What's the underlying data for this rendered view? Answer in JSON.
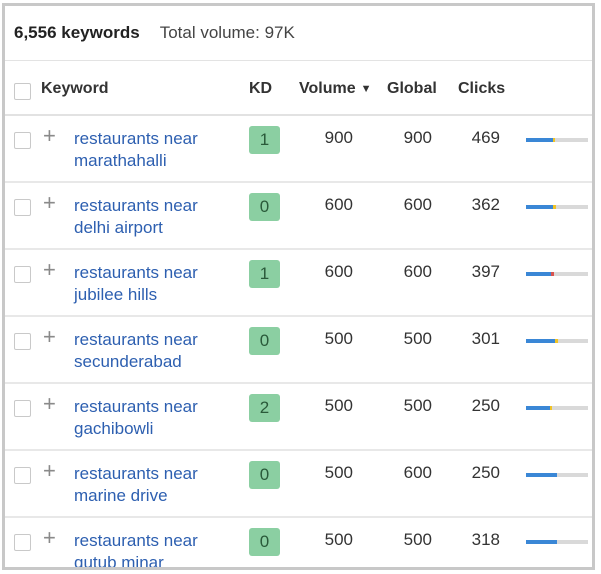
{
  "summary": {
    "keyword_count": "6,556 keywords",
    "total_volume": "Total volume: 97K"
  },
  "columns": {
    "keyword": "Keyword",
    "kd": "KD",
    "volume": "Volume",
    "volume_sort_icon": "▼",
    "global": "Global",
    "clicks": "Clicks"
  },
  "colors": {
    "link": "#2d5fb0",
    "kd_badge_bg": "#8bcfa2",
    "bar_blue": "#3a87d6",
    "bar_yellow": "#f0c325",
    "bar_red": "#d9534f",
    "bar_track": "#d9d9d9"
  },
  "rows": [
    {
      "kw1": "restaurants near",
      "kw2": "marathahalli",
      "kd": "1",
      "volume": "900",
      "global": "900",
      "clicks": "469",
      "click_split": [
        {
          "share": 0.43,
          "color": "#3a87d6"
        },
        {
          "share": 0.04,
          "color": "#f0c325"
        }
      ]
    },
    {
      "kw1": "restaurants near",
      "kw2": "delhi airport",
      "kd": "0",
      "volume": "600",
      "global": "600",
      "clicks": "362",
      "click_split": [
        {
          "share": 0.44,
          "color": "#3a87d6"
        },
        {
          "share": 0.05,
          "color": "#f0c325"
        }
      ]
    },
    {
      "kw1": "restaurants near",
      "kw2": "jubilee hills",
      "kd": "1",
      "volume": "600",
      "global": "600",
      "clicks": "397",
      "click_split": [
        {
          "share": 0.4,
          "color": "#3a87d6"
        },
        {
          "share": 0.05,
          "color": "#d9534f"
        }
      ]
    },
    {
      "kw1": "restaurants near",
      "kw2": "secunderabad",
      "kd": "0",
      "volume": "500",
      "global": "500",
      "clicks": "301",
      "click_split": [
        {
          "share": 0.47,
          "color": "#3a87d6"
        },
        {
          "share": 0.05,
          "color": "#f0c325"
        }
      ]
    },
    {
      "kw1": "restaurants near",
      "kw2": "gachibowli",
      "kd": "2",
      "volume": "500",
      "global": "500",
      "clicks": "250",
      "click_split": [
        {
          "share": 0.38,
          "color": "#3a87d6"
        },
        {
          "share": 0.04,
          "color": "#f0c325"
        }
      ]
    },
    {
      "kw1": "restaurants near",
      "kw2": "marine drive",
      "kd": "0",
      "volume": "500",
      "global": "600",
      "clicks": "250",
      "click_split": [
        {
          "share": 0.5,
          "color": "#3a87d6"
        }
      ]
    },
    {
      "kw1": "restaurants near",
      "kw2": "qutub minar",
      "kd": "0",
      "volume": "500",
      "global": "500",
      "clicks": "318",
      "click_split": [
        {
          "share": 0.5,
          "color": "#3a87d6"
        }
      ]
    }
  ]
}
